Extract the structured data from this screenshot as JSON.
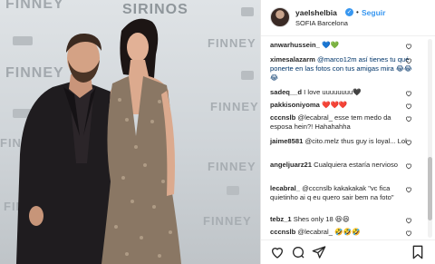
{
  "photo": {
    "watermarks": [
      "FINNEY",
      "SIRINOS",
      "FINNEY",
      "FINNEY",
      "FINNEY",
      "FINNEY",
      "FIN",
      "FINNEY",
      "FINNEY"
    ]
  },
  "post": {
    "username": "yaelshelbia",
    "follow_label": "Seguir",
    "separator": "•",
    "location": "SOFIA Barcelona",
    "verified_glyph": "✓"
  },
  "comments": [
    {
      "user": "anwarhussein_",
      "text": "💙💚"
    },
    {
      "user": "ximesalazarm",
      "text": "@marco12m así tienes tu qué ponerte en las fotos con tus amigas mira 😂😂😂"
    },
    {
      "user": "sadeq__d",
      "text": "I love uuuuuuuu🖤"
    },
    {
      "user": "pakkisoniyoma",
      "text": "❤️❤️❤️"
    },
    {
      "user": "cccnslb",
      "text": "@lecabral_ esse tem medo da esposa hein?! Hahahahha"
    },
    {
      "user": "jaime8581",
      "text": "@cito.melz thus guy is loyal... Lol"
    },
    {
      "user": "angeljuarz21",
      "text": "Cualquiera estaría nervioso"
    },
    {
      "user": "lecabral_",
      "text": "@cccnslb kakakakak \"vc fica quietinho ai q eu quero sair bem na foto\""
    },
    {
      "user": "tebz_1",
      "text": "Shes only 18 😆😆"
    },
    {
      "user": "cccnslb",
      "text": "@lecabral_ 🤣🤣🤣"
    }
  ],
  "icons": {
    "like": "heart-icon",
    "comment": "comment-icon",
    "share": "share-icon",
    "save": "bookmark-icon",
    "verified": "verified-badge-icon"
  },
  "colors": {
    "link_blue": "#3897f0",
    "mention": "#003569",
    "text": "#262626"
  }
}
